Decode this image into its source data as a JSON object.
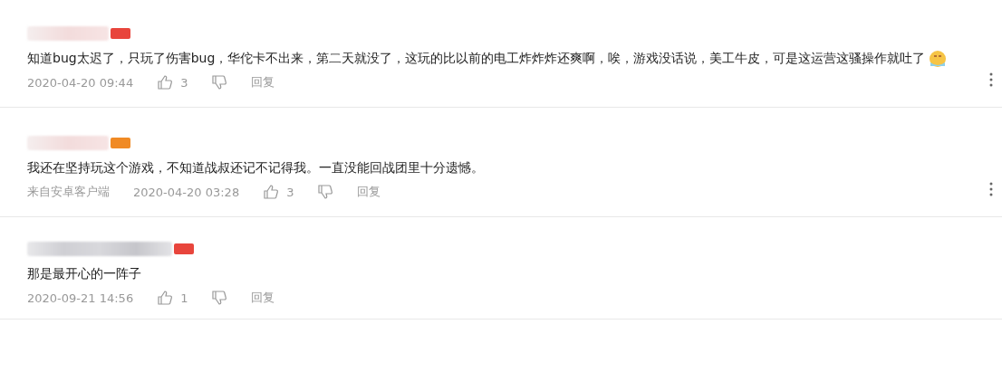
{
  "comments": [
    {
      "color": "#e8453c",
      "text": "知道bug太迟了，只玩了伤害bug，华佗卡不出来，第二天就没了，这玩的比以前的电工炸炸炸还爽啊，唉，游戏没话说，美工牛皮，可是这运营这骚操作就吐了",
      "has_emoji": true,
      "time": "2020-04-20 09:44",
      "likes": "3",
      "reply": "回复",
      "has_more": true
    },
    {
      "color": "#f08a24",
      "text": "我还在坚持玩这个游戏，不知道战叔还记不记得我。一直没能回战团里十分遗憾。",
      "has_emoji": false,
      "source": "来自安卓客户端",
      "time": "2020-04-20 03:28",
      "likes": "3",
      "reply": "回复",
      "has_more": true
    },
    {
      "color": "#e8453c",
      "text": "那是最开心的一阵子",
      "has_emoji": false,
      "time": "2020-09-21 14:56",
      "likes": "1",
      "reply": "回复",
      "has_more": false
    }
  ]
}
